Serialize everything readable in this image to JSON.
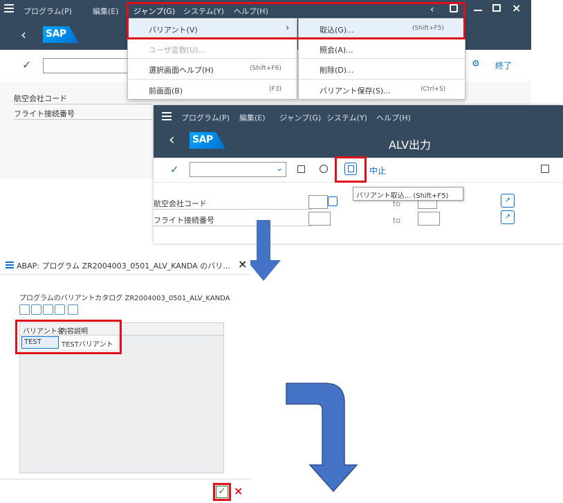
{
  "window1": {
    "menu": [
      "プログラム(P)",
      "編集(E)",
      "ジャンプ(G)",
      "システム(Y)",
      "ヘルプ(H)"
    ],
    "end_label": "終了",
    "fields": [
      {
        "label": "航空会社コード"
      },
      {
        "label": "フライト接続番号"
      }
    ]
  },
  "goto_menu": {
    "items": [
      {
        "label": "バリアント(V)",
        "shortcut": ""
      },
      {
        "label": "ユーザ変数(U)...",
        "shortcut": ""
      },
      {
        "label": "選択画面ヘルプ(H)",
        "shortcut": "(Shift+F6)"
      },
      {
        "label": "前画面(B)",
        "shortcut": "(F3)"
      }
    ]
  },
  "variant_submenu": {
    "items": [
      {
        "label": "取込(G)...",
        "shortcut": "(Shift+F5)"
      },
      {
        "label": "照会(A)...",
        "shortcut": ""
      },
      {
        "label": "削除(D)...",
        "shortcut": ""
      },
      {
        "label": "バリアント保存(S)...",
        "shortcut": "(Ctrl+S)"
      }
    ]
  },
  "window2": {
    "menu": [
      "プログラム(P)",
      "編集(E)",
      "ジャンプ(G)",
      "システム(Y)",
      "ヘルプ(H)"
    ],
    "title": "ALV出力",
    "cancel_label": "中止",
    "tooltip": "バリアント取込... (Shift+F5)",
    "fields": [
      {
        "label": "航空会社コード",
        "to": "to"
      },
      {
        "label": "フライト接続番号",
        "to": "to"
      }
    ]
  },
  "dialog": {
    "title": "ABAP: プログラム ZR2004003_0501_ALV_KANDA のバリ...",
    "catalog_title": "プログラムのバリアントカタログ ZR2004003_0501_ALV_KANDA",
    "columns": [
      "バリアント名",
      "内容説明"
    ],
    "rows": [
      {
        "name": "TEST",
        "desc": "TESTバリアント"
      }
    ]
  },
  "colors": {
    "shell": "#354a5f",
    "highlight": "#e0101a",
    "arrow": "#4472c4"
  }
}
